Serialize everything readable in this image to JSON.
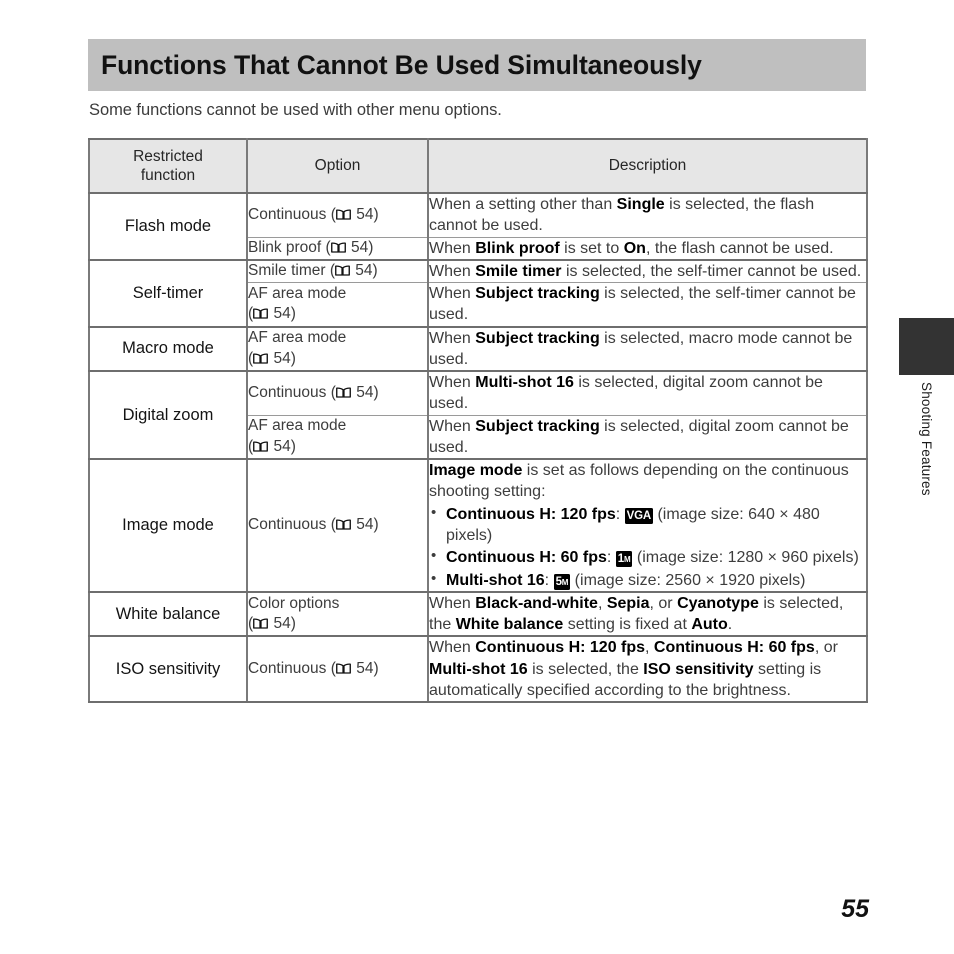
{
  "page": {
    "title": "Functions That Cannot Be Used Simultaneously",
    "intro": "Some functions cannot be used with other menu options.",
    "page_number": "55",
    "chapter_tab": "Shooting Features",
    "accent_title_bg": "#bfbfbf",
    "table_header_bg": "#e6e6e6",
    "tab_block_color": "#333333"
  },
  "table": {
    "headers": {
      "function": "Restricted\nfunction",
      "function_line1": "Restricted",
      "function_line2": "function",
      "option": "Option",
      "description": "Description"
    },
    "page_ref": "54",
    "rows": [
      {
        "function": "Flash mode",
        "entries": [
          {
            "option_text": "Continuous (",
            "option_ref": "54",
            "option_suffix": ")",
            "desc_parts": [
              {
                "t": "When a setting other than ",
                "b": false
              },
              {
                "t": "Single",
                "b": true
              },
              {
                "t": " is selected, the flash cannot be used.",
                "b": false
              }
            ]
          },
          {
            "option_text": "Blink proof (",
            "option_ref": "54",
            "option_suffix": ")",
            "desc_parts": [
              {
                "t": "When ",
                "b": false
              },
              {
                "t": "Blink proof",
                "b": true
              },
              {
                "t": " is set to ",
                "b": false
              },
              {
                "t": "On",
                "b": true
              },
              {
                "t": ", the flash cannot be used.",
                "b": false
              }
            ]
          }
        ]
      },
      {
        "function": "Self-timer",
        "entries": [
          {
            "option_text": "Smile timer (",
            "option_ref": "54",
            "option_suffix": ")",
            "desc_parts": [
              {
                "t": "When ",
                "b": false
              },
              {
                "t": "Smile timer",
                "b": true
              },
              {
                "t": " is selected, the self-timer cannot be used.",
                "b": false
              }
            ]
          },
          {
            "option_text": "AF area mode",
            "option_wrap": true,
            "option_ref": "54",
            "desc_parts": [
              {
                "t": "When ",
                "b": false
              },
              {
                "t": "Subject tracking",
                "b": true
              },
              {
                "t": " is selected, the self-timer cannot be used.",
                "b": false
              }
            ]
          }
        ]
      },
      {
        "function": "Macro mode",
        "entries": [
          {
            "option_text": "AF area mode",
            "option_wrap": true,
            "option_ref": "54",
            "desc_parts": [
              {
                "t": "When ",
                "b": false
              },
              {
                "t": "Subject tracking",
                "b": true
              },
              {
                "t": " is selected, macro mode cannot be used.",
                "b": false
              }
            ]
          }
        ]
      },
      {
        "function": "Digital zoom",
        "entries": [
          {
            "option_text": "Continuous (",
            "option_ref": "54",
            "option_suffix": ")",
            "desc_parts": [
              {
                "t": "When ",
                "b": false
              },
              {
                "t": "Multi-shot 16",
                "b": true
              },
              {
                "t": " is selected, digital zoom cannot be used.",
                "b": false
              }
            ]
          },
          {
            "option_text": "AF area mode",
            "option_wrap": true,
            "option_ref": "54",
            "desc_parts": [
              {
                "t": "When ",
                "b": false
              },
              {
                "t": "Subject tracking",
                "b": true
              },
              {
                "t": " is selected, digital zoom cannot be used.",
                "b": false
              }
            ]
          }
        ]
      },
      {
        "function": "Image mode",
        "entries": [
          {
            "option_text": "Continuous (",
            "option_ref": "54",
            "option_suffix": ")",
            "desc_intro": [
              {
                "t": "Image mode",
                "b": true
              },
              {
                "t": " is set as follows depending on the continuous shooting setting:",
                "b": false
              }
            ],
            "bullets": [
              {
                "label": "Continuous H: 120 fps",
                "badge": "VGA",
                "badge_sub": "",
                "tail": "(image size: 640 × 480 pixels)"
              },
              {
                "label": "Continuous H: 60 fps",
                "badge": "1",
                "badge_sub": "M",
                "tail": "(image size: 1280 × 960 pixels)"
              },
              {
                "label": "Multi-shot 16",
                "badge": "5",
                "badge_sub": "M",
                "tail": "(image size: 2560 × 1920 pixels)"
              }
            ]
          }
        ]
      },
      {
        "function": "White balance",
        "entries": [
          {
            "option_text": "Color options",
            "option_wrap": true,
            "option_ref": "54",
            "desc_parts": [
              {
                "t": "When ",
                "b": false
              },
              {
                "t": "Black-and-white",
                "b": true
              },
              {
                "t": ", ",
                "b": false
              },
              {
                "t": "Sepia",
                "b": true
              },
              {
                "t": ", or ",
                "b": false
              },
              {
                "t": "Cyanotype",
                "b": true
              },
              {
                "t": " is selected, the ",
                "b": false
              },
              {
                "t": "White balance",
                "b": true
              },
              {
                "t": " setting is fixed at ",
                "b": false
              },
              {
                "t": "Auto",
                "b": true
              },
              {
                "t": ".",
                "b": false
              }
            ]
          }
        ]
      },
      {
        "function": "ISO sensitivity",
        "entries": [
          {
            "option_text": "Continuous (",
            "option_ref": "54",
            "option_suffix": ")",
            "desc_parts": [
              {
                "t": "When ",
                "b": false
              },
              {
                "t": "Continuous H: 120 fps",
                "b": true
              },
              {
                "t": ", ",
                "b": false
              },
              {
                "t": "Continuous H: 60 fps",
                "b": true
              },
              {
                "t": ", or ",
                "b": false
              },
              {
                "t": "Multi-shot 16",
                "b": true
              },
              {
                "t": " is selected, the ",
                "b": false
              },
              {
                "t": "ISO sensitivity",
                "b": true
              },
              {
                "t": " setting is automatically specified according to the brightness.",
                "b": false
              }
            ]
          }
        ]
      }
    ]
  }
}
